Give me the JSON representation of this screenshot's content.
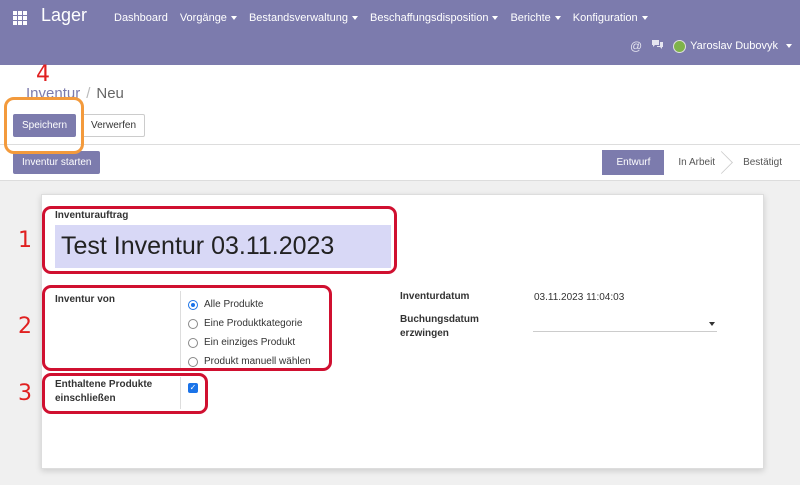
{
  "app": {
    "title": "Lager"
  },
  "nav": {
    "items": [
      {
        "label": "Dashboard",
        "dropdown": false
      },
      {
        "label": "Vorgänge",
        "dropdown": true
      },
      {
        "label": "Bestandsverwaltung",
        "dropdown": true
      },
      {
        "label": "Beschaffungsdisposition",
        "dropdown": true
      },
      {
        "label": "Berichte",
        "dropdown": true
      },
      {
        "label": "Konfiguration",
        "dropdown": true
      }
    ],
    "user": "Yaroslav Dubovyk",
    "icons": [
      "at-icon",
      "chat-icon"
    ]
  },
  "breadcrumb": {
    "parent": "Inventur",
    "current": "Neu"
  },
  "buttons": {
    "save": "Speichern",
    "discard": "Verwerfen",
    "start": "Inventur starten"
  },
  "statusbar": {
    "steps": [
      "Entwurf",
      "In Arbeit",
      "Bestätigt"
    ],
    "active_index": 0
  },
  "form": {
    "name_label": "Inventurauftrag",
    "name_value": "Test Inventur 03.11.2023",
    "inventory_of_label": "Inventur von",
    "inventory_of_options": [
      "Alle Produkte",
      "Eine Produktkategorie",
      "Ein einziges Produkt",
      "Produkt manuell wählen"
    ],
    "inventory_of_selected": 0,
    "include_products_label_1": "Enthaltene Produkte",
    "include_products_label_2": "einschließen",
    "include_products_checked": true,
    "date_label": "Inventurdatum",
    "date_value": "03.11.2023 11:04:03",
    "accounting_date_label_1": "Buchungsdatum",
    "accounting_date_label_2": "erzwingen",
    "accounting_date_value": ""
  },
  "annotations": [
    "1",
    "2",
    "3",
    "4"
  ],
  "colors": {
    "brand": "#7c7bad",
    "input_highlight": "#d8d8f6",
    "annotation_red": "#d01030",
    "annotation_orange": "#f39a3c"
  }
}
